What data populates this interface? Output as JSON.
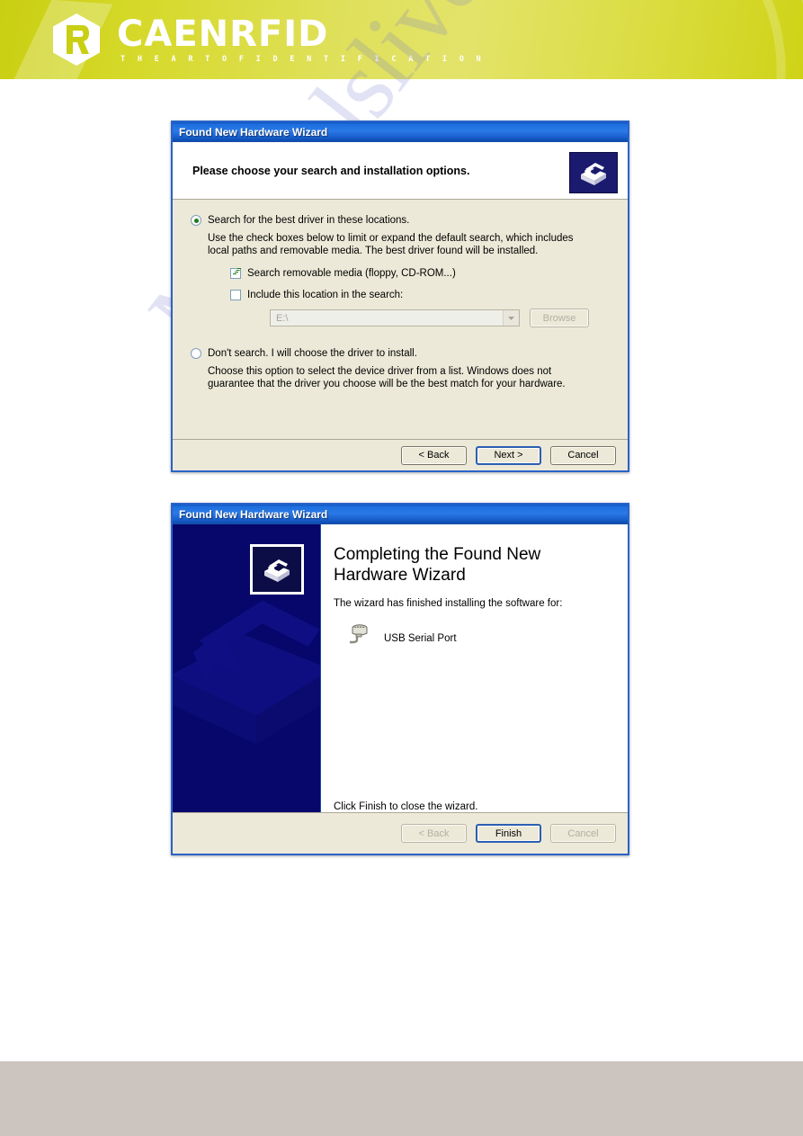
{
  "header": {
    "brand": "CAENRFID",
    "tagline": "T H E   A R T   O F   I D E N T I F I C A T I O N",
    "logo_icon": "hexagon-r-logo",
    "bg_color_start": "#c9cf12",
    "bg_color_end": "#e3e36a"
  },
  "page_watermark": {
    "text": "Manualslive.com"
  },
  "dialog1": {
    "title": "Found New Hardware Wizard",
    "header_title": "Please choose your search and installation options.",
    "header_icon": "wizard-hardware-icon",
    "option_search": {
      "label": "Search for the best driver in these locations.",
      "selected": true,
      "description": "Use the check boxes below to limit or expand the default search, which includes local paths and removable media. The best driver found will be installed."
    },
    "checkbox_removable": {
      "label": "Search removable media (floppy, CD-ROM...)",
      "checked": true
    },
    "checkbox_location": {
      "label": "Include this location in the search:",
      "checked": false
    },
    "location_combo": {
      "value": "E:\\",
      "disabled": true,
      "arrow_icon": "chevron-down-icon"
    },
    "browse_button": {
      "label": "Browse",
      "disabled": true
    },
    "option_manual": {
      "label": "Don't search. I will choose the driver to install.",
      "selected": false,
      "description": "Choose this option to select the device driver from a list.  Windows does not guarantee that the driver you choose will be the best match for your hardware."
    },
    "buttons": {
      "back": "< Back",
      "next": "Next >",
      "cancel": "Cancel"
    }
  },
  "dialog2": {
    "title": "Found New Hardware Wizard",
    "heading": "Completing the Found New Hardware Wizard",
    "subtext": "The wizard has finished installing the software for:",
    "device": {
      "name": "USB Serial Port",
      "icon": "serial-port-icon"
    },
    "footer_text": "Click Finish to close the wizard.",
    "sidebar_icon": "wizard-hardware-icon",
    "buttons": {
      "back": "< Back",
      "finish": "Finish",
      "cancel": "Cancel"
    }
  }
}
